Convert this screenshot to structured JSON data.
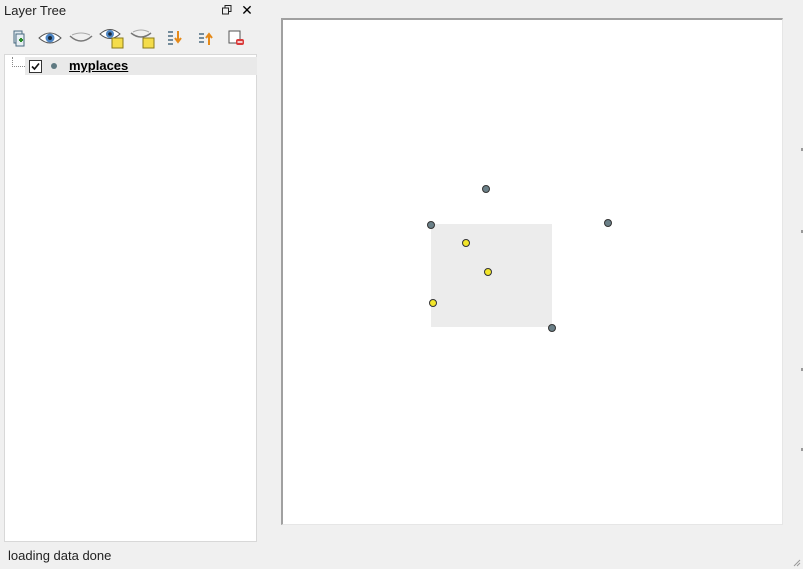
{
  "dock": {
    "title": "Layer Tree",
    "toolbar_icons": [
      "add-group-icon",
      "show-layers-icon",
      "hide-layers-icon",
      "show-selected-icon",
      "hide-selected-icon",
      "expand-all-icon",
      "collapse-all-icon",
      "remove-layer-icon"
    ]
  },
  "layers": [
    {
      "name": "myplaces",
      "checked": true,
      "symbol_color": "#5f7a82"
    }
  ],
  "map": {
    "features": [
      {
        "name": "gray-point",
        "color": "#6b8088"
      },
      {
        "name": "yellow-point",
        "color": "#f2e52a"
      }
    ],
    "extent_fill": "#ececec"
  },
  "status": {
    "text": "loading data done"
  }
}
